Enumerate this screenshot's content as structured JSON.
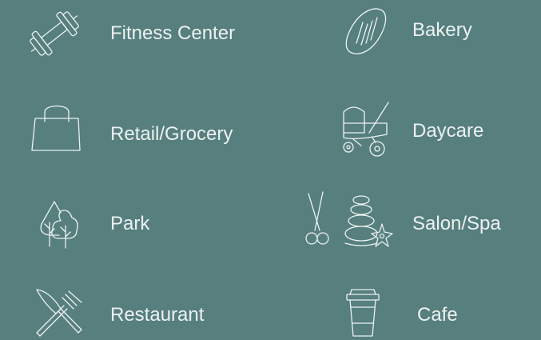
{
  "colors": {
    "background": "#567f7e",
    "foreground": "#ecf2f1"
  },
  "amenities": [
    {
      "label": "Fitness Center",
      "icon": "dumbbell-icon"
    },
    {
      "label": "Bakery",
      "icon": "bread-loaf-icon"
    },
    {
      "label": "Retail/Grocery",
      "icon": "shopping-bag-icon"
    },
    {
      "label": "Daycare",
      "icon": "baby-stroller-icon"
    },
    {
      "label": "Park",
      "icon": "trees-icon"
    },
    {
      "label": "Salon/Spa",
      "icon": "scissors-spa-stones-icon"
    },
    {
      "label": "Restaurant",
      "icon": "fork-knife-icon"
    },
    {
      "label": "Cafe",
      "icon": "coffee-cup-icon"
    }
  ]
}
